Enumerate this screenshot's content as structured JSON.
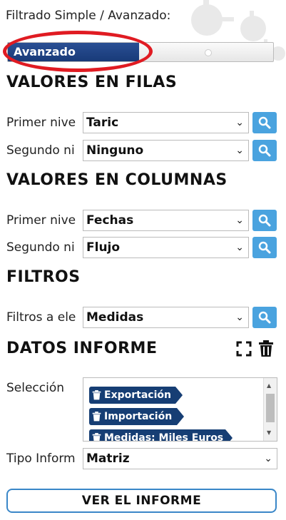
{
  "mode": {
    "label": "Filtrado Simple / Avanzado:",
    "active_option": "Avanzado"
  },
  "rows_section": {
    "title": "VALORES EN FILAS",
    "first": {
      "label": "Primer nive",
      "value": "Taric"
    },
    "second": {
      "label": "Segundo ni",
      "value": "Ninguno"
    }
  },
  "columns_section": {
    "title": "VALORES EN COLUMNAS",
    "first": {
      "label": "Primer nive",
      "value": "Fechas"
    },
    "second": {
      "label": "Segundo ni",
      "value": "Flujo"
    }
  },
  "filters_section": {
    "title": "FILTROS",
    "filter": {
      "label": "Filtros a ele",
      "value": "Medidas"
    }
  },
  "report_section": {
    "title": "DATOS INFORME",
    "selection_label": "Selección",
    "tags": [
      "Exportación",
      "Importación",
      "Medidas: Miles Euros"
    ],
    "type_label": "Tipo Inform",
    "type_value": "Matriz"
  },
  "view_report_button": "VER EL INFORME",
  "colors": {
    "accent_blue": "#4aa3df",
    "dark_blue": "#163e74",
    "highlight_red": "#e01b22",
    "button_border": "#3a87c8"
  }
}
